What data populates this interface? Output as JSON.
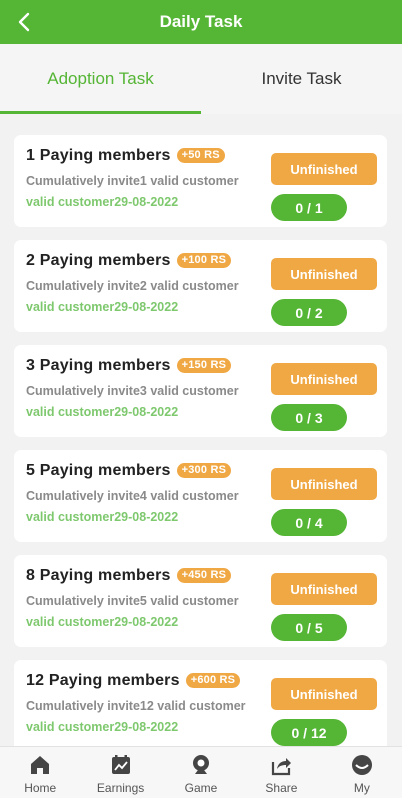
{
  "header": {
    "title": "Daily Task"
  },
  "tabs": [
    {
      "label": "Adoption Task",
      "active": true
    },
    {
      "label": "Invite Task",
      "active": false
    }
  ],
  "colors": {
    "brand": "#55b535",
    "warning": "#f0a845",
    "muted_green": "#7ec86e"
  },
  "tasks": [
    {
      "name": "1 Paying members",
      "reward": "+50 RS",
      "desc": "Cumulatively invite1 valid customer",
      "date": "valid customer29-08-2022",
      "status": "Unfinished",
      "progress": "0 / 1"
    },
    {
      "name": "2 Paying members",
      "reward": "+100 RS",
      "desc": "Cumulatively invite2 valid customer",
      "date": "valid customer29-08-2022",
      "status": "Unfinished",
      "progress": "0 / 2"
    },
    {
      "name": "3 Paying members",
      "reward": "+150 RS",
      "desc": "Cumulatively invite3 valid customer",
      "date": "valid customer29-08-2022",
      "status": "Unfinished",
      "progress": "0 / 3"
    },
    {
      "name": "5 Paying members",
      "reward": "+300 RS",
      "desc": "Cumulatively invite4 valid customer",
      "date": "valid customer29-08-2022",
      "status": "Unfinished",
      "progress": "0 / 4"
    },
    {
      "name": "8 Paying members",
      "reward": "+450 RS",
      "desc": "Cumulatively invite5 valid customer",
      "date": "valid customer29-08-2022",
      "status": "Unfinished",
      "progress": "0 / 5"
    },
    {
      "name": "12 Paying members",
      "reward": "+600 RS",
      "desc": "Cumulatively invite12 valid customer",
      "date": "valid customer29-08-2022",
      "status": "Unfinished",
      "progress": "0 / 12"
    }
  ],
  "nav": [
    {
      "label": "Home",
      "icon": "home-icon"
    },
    {
      "label": "Earnings",
      "icon": "earnings-icon"
    },
    {
      "label": "Game",
      "icon": "game-icon"
    },
    {
      "label": "Share",
      "icon": "share-icon"
    },
    {
      "label": "My",
      "icon": "profile-icon"
    }
  ]
}
